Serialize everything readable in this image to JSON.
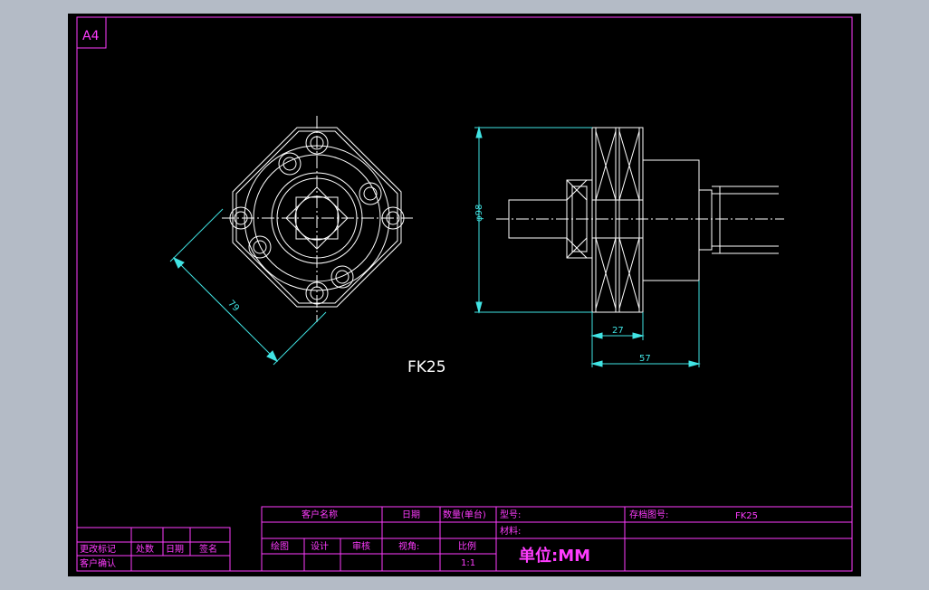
{
  "sheet": {
    "size_label": "A4",
    "part_label": "FK25",
    "dimensions": {
      "diagonal": "79",
      "diameter": "φ98",
      "width_a": "27",
      "width_b": "57"
    }
  },
  "title_block": {
    "left": {
      "row1": [
        "更改标记",
        "处数",
        "日期",
        "签名"
      ],
      "row2": [
        "客户确认"
      ]
    },
    "right": {
      "customer_name": "客户名称",
      "date": "日期",
      "quantity": "数量(单台)",
      "model": "型号:",
      "drawing_no_label": "存档图号:",
      "drawing_no_value": "FK25",
      "material": "材料:",
      "drawn": "绘图",
      "designed": "设计",
      "reviewed": "审核",
      "view_angle": "视角:",
      "scale_label": "比例",
      "scale_value": "1:1",
      "unit": "单位:MM"
    }
  },
  "colors": {
    "background": "#000000",
    "border": "#ff3cff",
    "geometry": "#ffffff",
    "dimension": "#41e4e4",
    "outer": "#b4bbc6"
  }
}
